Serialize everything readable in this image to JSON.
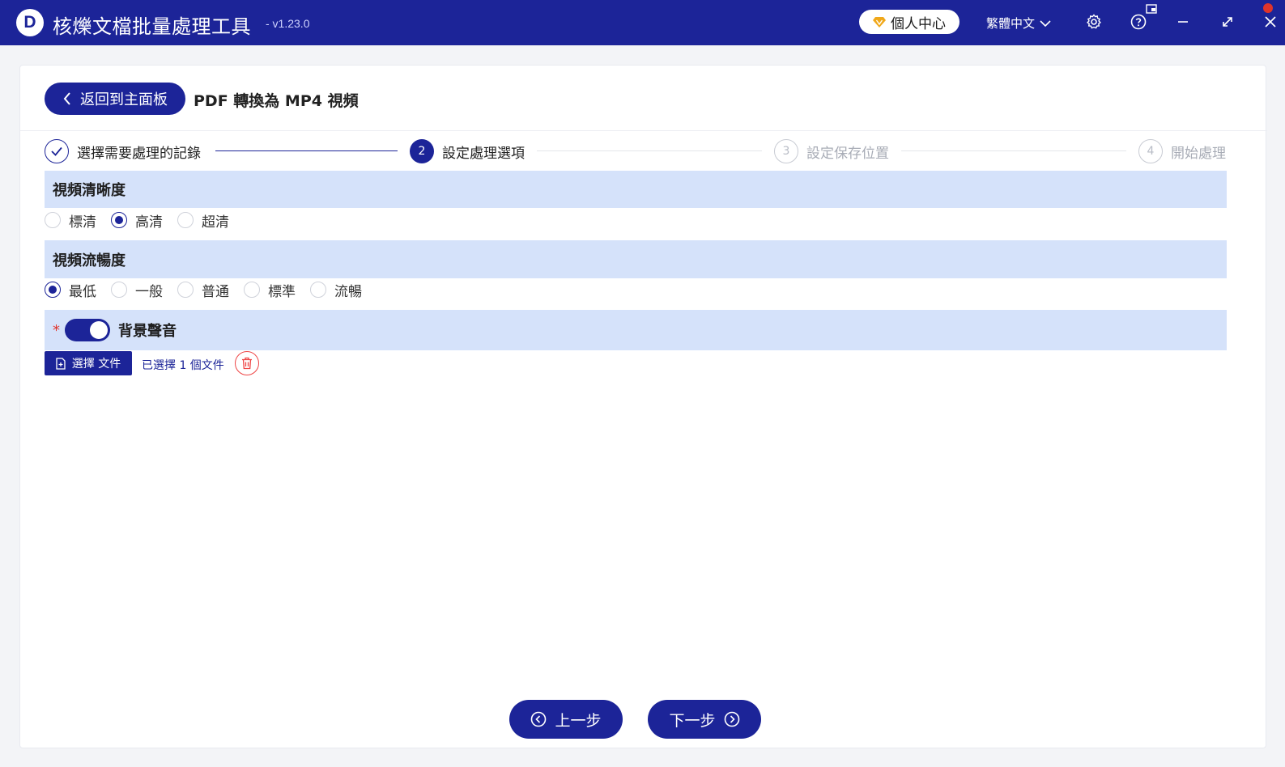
{
  "app": {
    "logo_letter": "D",
    "title": "核爍文檔批量處理工具",
    "version": "- v1.23.0",
    "brand_color": "#1c2498"
  },
  "header_actions": {
    "user_center_label": "個人中心",
    "language_label": "繁體中文"
  },
  "page": {
    "back_label": "返回到主面板",
    "title": "PDF 轉換為 MP4 視頻"
  },
  "steps": [
    {
      "number": "",
      "label": "選擇需要處理的記錄",
      "state": "done"
    },
    {
      "number": "2",
      "label": "設定處理選項",
      "state": "active"
    },
    {
      "number": "3",
      "label": "設定保存位置",
      "state": "pending"
    },
    {
      "number": "4",
      "label": "開始處理",
      "state": "pending"
    }
  ],
  "sections": {
    "resolution": {
      "title": "視頻清晰度",
      "options": [
        "標清",
        "高清",
        "超清"
      ],
      "selected": "高清"
    },
    "smoothness": {
      "title": "視頻流暢度",
      "options": [
        "最低",
        "一般",
        "普通",
        "標準",
        "流暢"
      ],
      "selected": "最低"
    },
    "background_audio": {
      "required_mark": "*",
      "title": "背景聲音",
      "enabled": true,
      "choose_file_label": "選擇 文件",
      "file_status": "已選擇 1 個文件"
    }
  },
  "footer": {
    "prev_label": "上一步",
    "next_label": "下一步"
  }
}
